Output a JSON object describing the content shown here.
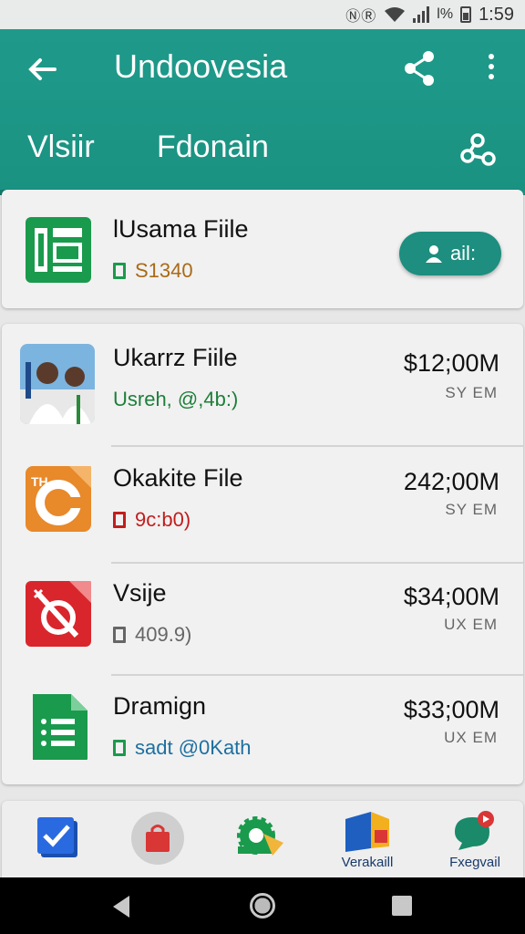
{
  "status_bar": {
    "icons_text": "ⓃⓇ",
    "battery_text": "l%",
    "time": "1:59"
  },
  "app_bar": {
    "title": "Undoovesia",
    "tabs": [
      {
        "label": "Vlsiir",
        "selected": true
      },
      {
        "label": "Fdonain",
        "selected": false
      }
    ],
    "icons": [
      "back-arrow-icon",
      "share-icon",
      "more-vert-icon",
      "link-icon"
    ]
  },
  "top_file": {
    "name": "lUsama Fiile",
    "sub": "S1340",
    "sub_color": "#a96a16",
    "button_label": "ail:",
    "icon": "sheets-icon"
  },
  "files": [
    {
      "name": "Ukarrz Fiile",
      "sub": "Usreh, @,4b:)",
      "sub_color": "#1d7f3a",
      "amount": "$12;00M",
      "unit": "SY EM",
      "icon": "photo-thumbnail"
    },
    {
      "name": "Okakite File",
      "sub": "9c:b0)",
      "sub_color": "#c21d1d",
      "amount": "242;00M",
      "unit": "SY EM",
      "icon": "orange-app-icon"
    },
    {
      "name": "Vsije",
      "sub": "409.9)",
      "sub_color": "#666666",
      "amount": "$34;00M",
      "unit": "UX EM",
      "icon": "red-app-icon"
    },
    {
      "name": "Dramign",
      "sub": "sadt @0Kath",
      "sub_color": "#1d6fa0",
      "amount": "$33;00M",
      "unit": "UX EM",
      "icon": "green-list-icon"
    }
  ],
  "bottom_nav": [
    {
      "label": "",
      "icon": "blue-check-icon"
    },
    {
      "label": "",
      "icon": "red-bag-icon"
    },
    {
      "label": "",
      "icon": "green-gear-icon"
    },
    {
      "label": "Verakaill",
      "icon": "blue-flag-icon"
    },
    {
      "label": "Fxegvail",
      "icon": "chat-bubble-icon"
    }
  ],
  "colors": {
    "primary": "#1f9a8a",
    "primary_dark": "#15786b"
  }
}
